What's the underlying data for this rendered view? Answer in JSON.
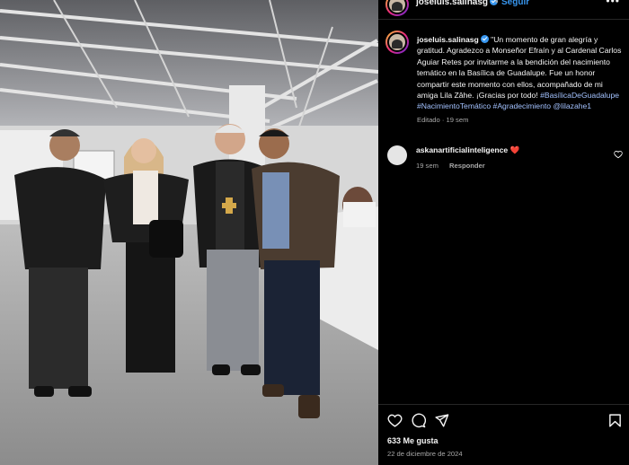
{
  "post": {
    "username": "joseluis.salinasg",
    "separator": "•",
    "follow_label": "Seguir",
    "more_label": "•••",
    "caption_text": "\"Un momento de gran alegría y gratitud. Agradezco a Monseñor Efraín y al Cardenal Carlos Aguiar Retes por invitarme a la bendición del nacimiento temático en la Basílica de Guadalupe. Fue un honor compartir este momento con ellos, acompañado de mi amiga Lila Zâhe. ¡Gracias por todo!",
    "hashtags": [
      "#BasílicaDeGuadalupe",
      "#NacimientoTemático",
      "#Agradecimiento"
    ],
    "mention": "@lilazahe1",
    "caption_meta": "Editado · 19 sem",
    "likes": "633 Me gusta",
    "date": "22 de diciembre de 2024"
  },
  "comment": {
    "username": "askanartificialinteligence",
    "emoji": "❤️",
    "time": "19 sem",
    "reply_label": "Responder"
  },
  "icons": {
    "like": "heart-outline-icon",
    "comment": "comment-icon",
    "share": "send-icon",
    "save": "bookmark-icon"
  },
  "colors": {
    "background": "#000000",
    "link": "#3897f0",
    "hashtag": "#a3c2ff",
    "secondary_text": "#a8a8a8",
    "heart": "#ff3040"
  }
}
